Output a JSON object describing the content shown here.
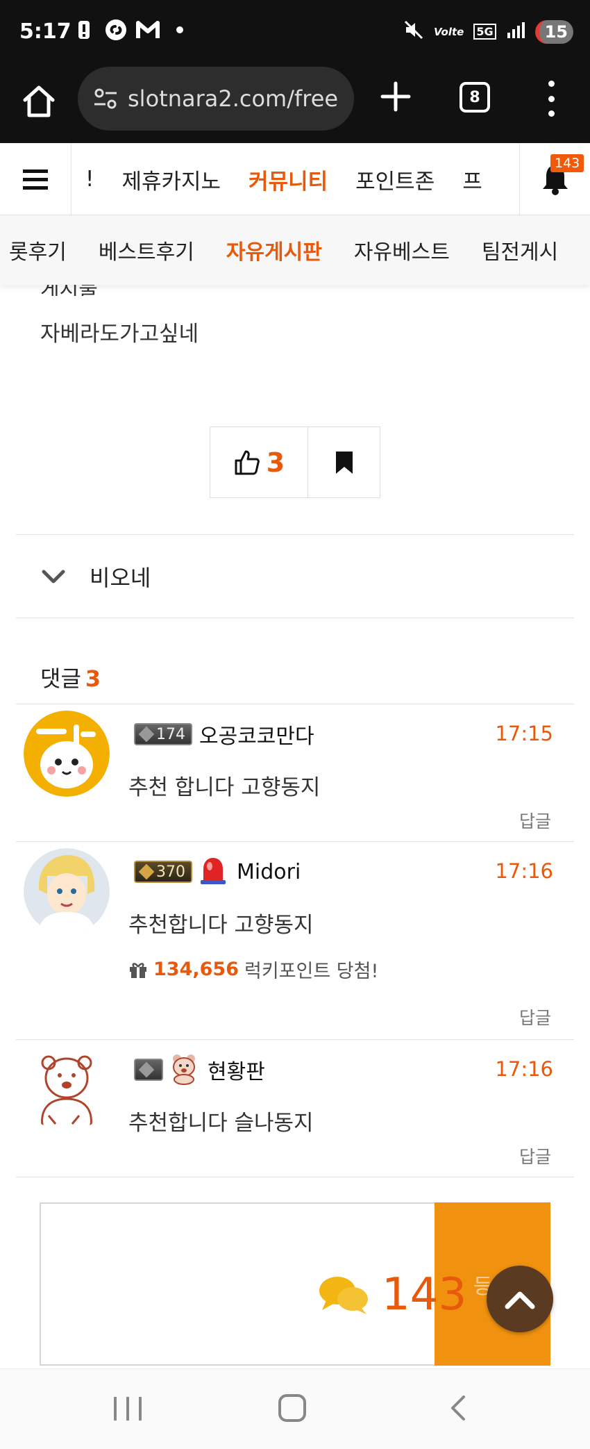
{
  "status_bar": {
    "time": "5:17",
    "battery": "15",
    "network": "5G",
    "lte": "Volte",
    "icons": [
      "alert-icon",
      "shazam-icon",
      "gmail-icon",
      "dot-icon",
      "mute-icon",
      "signal-icon"
    ]
  },
  "browser": {
    "url": "slotnara2.com/free",
    "tab_count": "8"
  },
  "site_nav": {
    "items": [
      {
        "label": "!"
      },
      {
        "label": "제휴카지노"
      },
      {
        "label": "커뮤니티",
        "active": true
      },
      {
        "label": "포인트존"
      },
      {
        "label": "프"
      }
    ],
    "notification_count": "143"
  },
  "sub_nav": {
    "items": [
      {
        "label": "롯후기"
      },
      {
        "label": "베스트후기"
      },
      {
        "label": "자유게시판",
        "active": true
      },
      {
        "label": "자유베스트"
      },
      {
        "label": "팀전게시"
      }
    ]
  },
  "post": {
    "clipped_line": "게시물",
    "body_text": "자베라도가고싶네",
    "like_count": "3",
    "author_name": "비오네"
  },
  "comments_section": {
    "label": "댓글",
    "count": "3",
    "comments": [
      {
        "level": "174",
        "nickname": "오공코코만다",
        "time": "17:15",
        "text": "추천 합니다 고향동지",
        "reply_label": "답글"
      },
      {
        "level": "370",
        "nickname": "Midori",
        "time": "17:16",
        "text": "추천합니다 고향동지",
        "lucky_points": "134,656",
        "lucky_label": "럭키포인트 당첨!",
        "reply_label": "답글"
      },
      {
        "level": "",
        "nickname": "현황판",
        "time": "17:16",
        "text": "추천합니다 슬나동지",
        "reply_label": "답글"
      }
    ]
  },
  "editor": {
    "submit_label": "등록",
    "chat_count": "143"
  },
  "colors": {
    "accent": "#e8590c",
    "submit": "#f0920f",
    "top_button": "#5a3b22"
  }
}
